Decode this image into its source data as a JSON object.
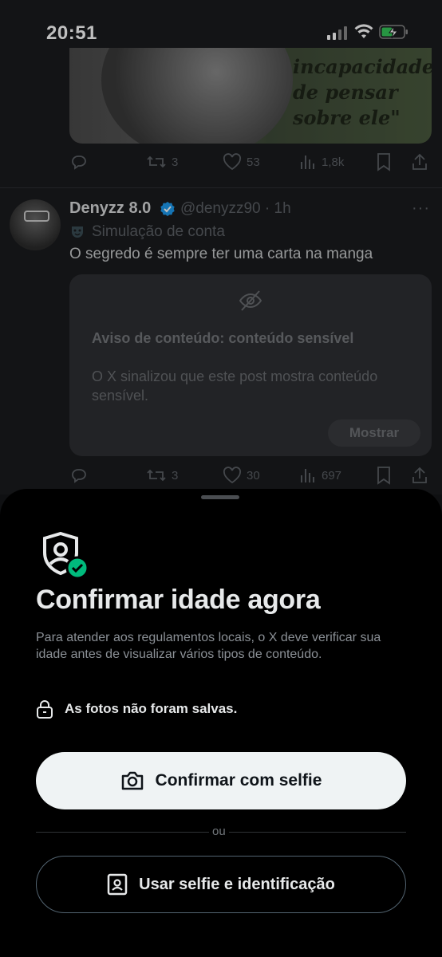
{
  "status_bar": {
    "time": "20:51"
  },
  "post1": {
    "quote": "incapacidade\nde pensar\nsobre ele\"",
    "actions": {
      "retweets": "3",
      "likes": "53",
      "views": "1,8k"
    }
  },
  "post2": {
    "name": "Denyzz 8.0",
    "handle": "@denyzz90 · 1h",
    "label": "Simulação de conta",
    "text": "O segredo é sempre ter uma carta na manga",
    "sensitive": {
      "title": "Aviso de conteúdo: conteúdo sensível",
      "description": "O X sinalizou que este post mostra conteúdo sensível.",
      "show_label": "Mostrar"
    },
    "actions": {
      "retweets": "3",
      "likes": "30",
      "views": "697"
    }
  },
  "sheet": {
    "title": "Confirmar idade agora",
    "description": "Para atender aos regulamentos locais, o X deve verificar sua idade antes de visualizar vários tipos de conteúdo.",
    "photos_note": "As fotos não foram salvas.",
    "primary_label": "Confirmar com selfie",
    "or_label": "ou",
    "secondary_label": "Usar selfie e identificação"
  },
  "colors": {
    "accent": "#1d9bf0",
    "success": "#00ba7c",
    "sheet_bg": "#000000"
  }
}
